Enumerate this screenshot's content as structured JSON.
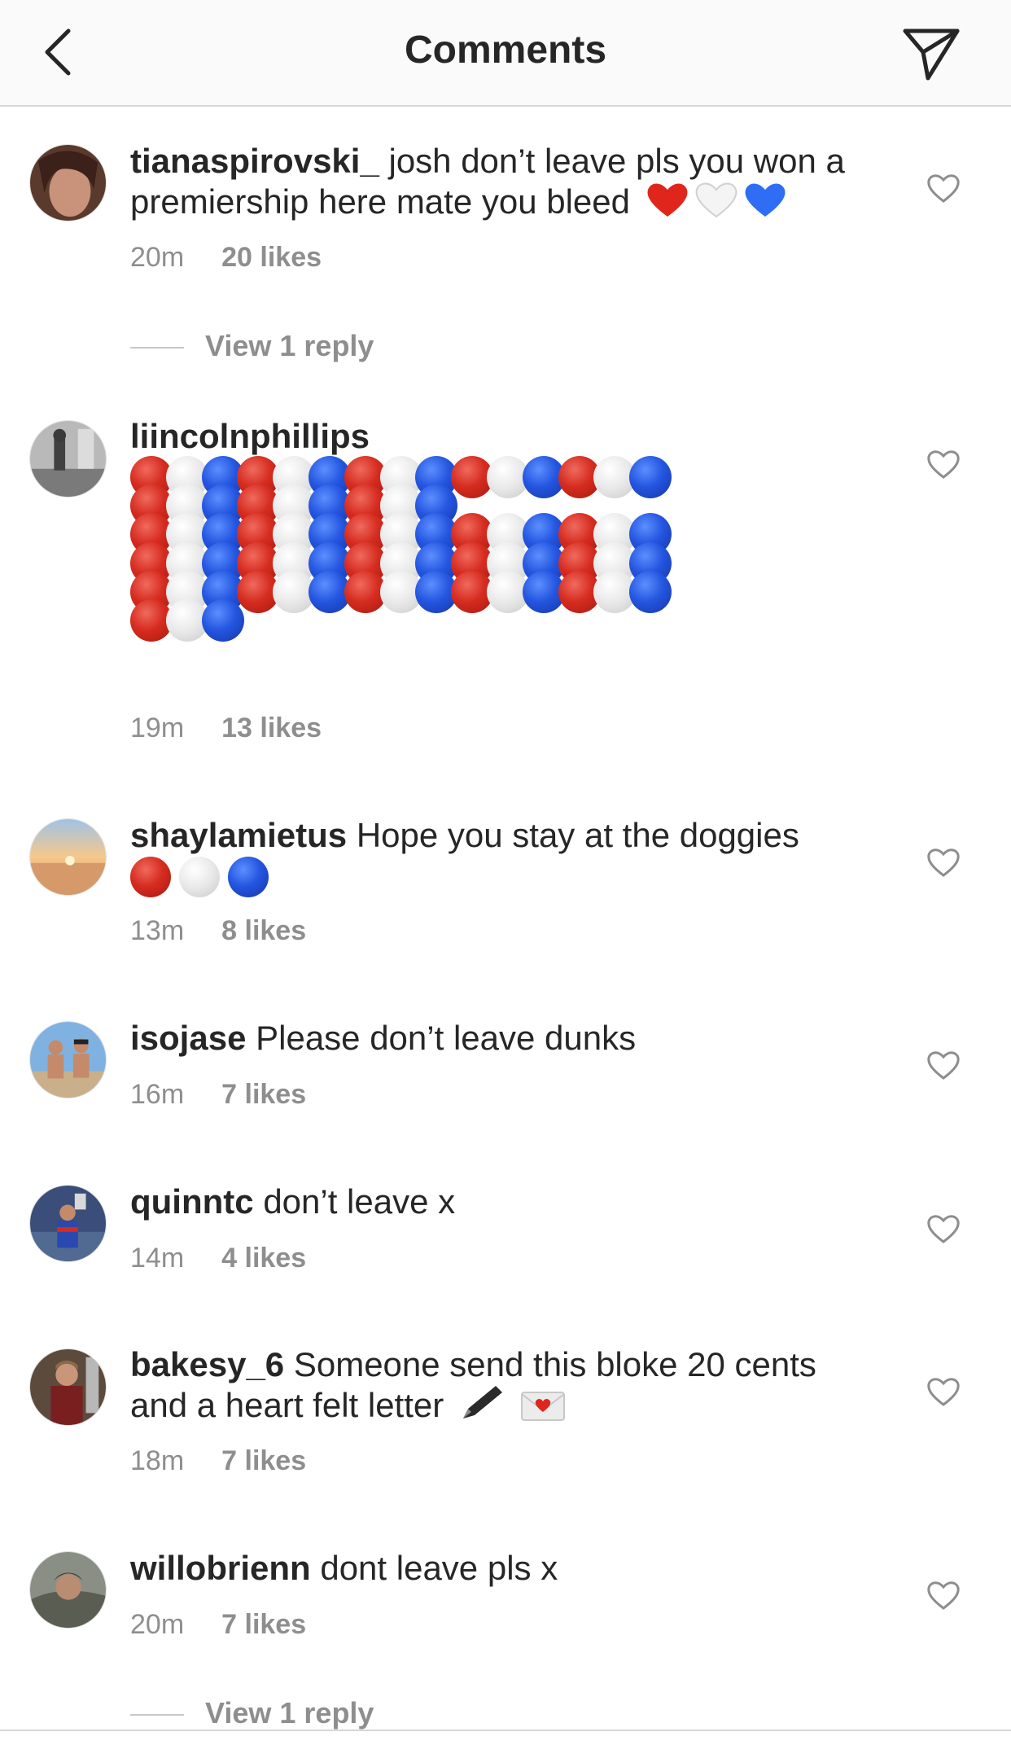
{
  "header": {
    "title": "Comments",
    "back_icon": "chevron-left-icon",
    "send_icon": "paper-plane-icon"
  },
  "comments": [
    {
      "username": "tianaspirovski_",
      "text": "josh don’t leave pls you won a premiership here mate you bleed",
      "emoji": [
        "red-heart",
        "white-heart",
        "blue-heart"
      ],
      "time": "20m",
      "likes": "20 likes",
      "reply": "View 1 reply"
    },
    {
      "username": "liincolnphillips",
      "text": "",
      "time": "19m",
      "likes": "13 likes"
    },
    {
      "username": "shaylamietus",
      "text": "Hope you stay at the doggies",
      "emoji": [
        "red-circle",
        "white-circle",
        "blue-circle"
      ],
      "time": "13m",
      "likes": "8 likes"
    },
    {
      "username": "isojase",
      "text": "Please don’t leave dunks",
      "time": "16m",
      "likes": "7 likes"
    },
    {
      "username": "quinntc",
      "text": "don’t leave x",
      "time": "14m",
      "likes": "4 likes"
    },
    {
      "username": "bakesy_6",
      "text": "Someone send this bloke 20 cents and a heart felt letter",
      "emoji": [
        "pen",
        "love-letter"
      ],
      "time": "18m",
      "likes": "7 likes"
    },
    {
      "username": "willobrienn",
      "text": "dont leave pls x",
      "time": "20m",
      "likes": "7 likes",
      "reply": "View 1 reply"
    }
  ],
  "emoji_art": {
    "rows": [
      "rwbrwbrwbrwbrwb",
      "rwbrwbrwb",
      "rwbrwbrwbrwbrwb",
      "rwbrwbrwbrwbrwb",
      "rwbrwbrwbrwbrwb",
      "rwb"
    ]
  },
  "colors": {
    "red": "#d62c20",
    "white": "#e8e8e8",
    "blue": "#2456e0",
    "text": "#262626",
    "muted": "#8e8e8e"
  }
}
